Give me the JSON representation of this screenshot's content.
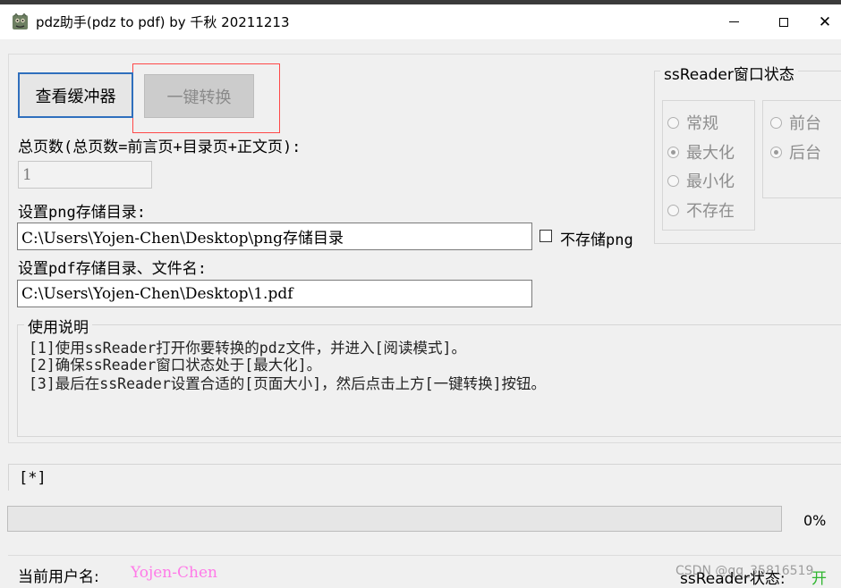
{
  "window": {
    "title": "pdz助手(pdz to pdf) by 千秋 20211213",
    "close_glyph": "✕",
    "icon": "app-icon"
  },
  "toolbar": {
    "view_buffer_label": "查看缓冲器",
    "convert_label": "一键转换"
  },
  "pages": {
    "label": "总页数(总页数=前言页+目录页+正文页):",
    "value": "1"
  },
  "png": {
    "label": "设置png存储目录:",
    "value": "C:\\Users\\Yojen-Chen\\Desktop\\png存储目录",
    "no_store_label": "不存储png"
  },
  "pdf": {
    "label": "设置pdf存储目录、文件名:",
    "value": "C:\\Users\\Yojen-Chen\\Desktop\\1.pdf"
  },
  "ssreader_state": {
    "title": "ssReader窗口状态",
    "window_options": [
      "常规",
      "最大化",
      "最小化",
      "不存在"
    ],
    "window_selected": "最大化",
    "focus_options": [
      "前台",
      "后台"
    ],
    "focus_selected": "后台"
  },
  "usage": {
    "title": "使用说明",
    "lines": [
      "[1]使用ssReader打开你要转换的pdz文件，并进入[阅读模式]。",
      "[2]确保ssReader窗口状态处于[最大化]。",
      "[3]最后在ssReader设置合适的[页面大小]，然后点击上方[一键转换]按钮。"
    ]
  },
  "status_text": "[*]",
  "progress": {
    "value": 0,
    "label": "0%"
  },
  "footer": {
    "user_label": "当前用户名:",
    "user_name": "Yojen-Chen",
    "ss_status_label": "ssReader状态:",
    "ss_status_value": "开",
    "watermark": "CSDN @qq_35816519"
  },
  "colors": {
    "accent_border": "#2f6fbd",
    "highlight_box": "#ff4848",
    "username": "#ff7ae8",
    "status_on": "#2fb52f",
    "progress_fill": "#06b025"
  }
}
